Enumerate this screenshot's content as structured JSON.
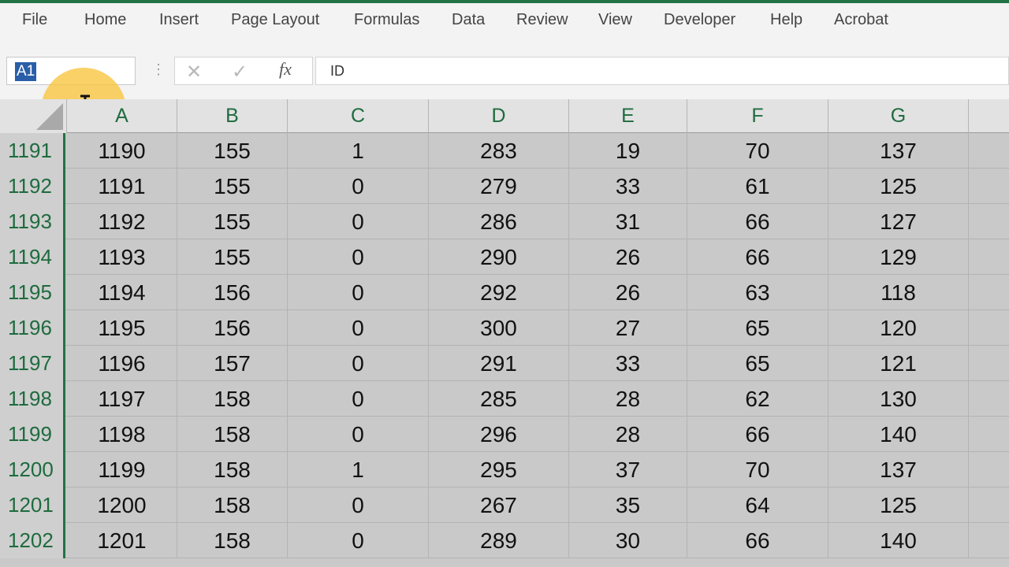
{
  "menu": [
    "File",
    "Home",
    "Insert",
    "Page Layout",
    "Formulas",
    "Data",
    "Review",
    "View",
    "Developer",
    "Help",
    "Acrobat"
  ],
  "name_box": {
    "value": "A1"
  },
  "formula_bar": {
    "cancel_glyph": "✕",
    "enter_glyph": "✓",
    "fx_label": "fx",
    "value": "ID"
  },
  "columns": [
    "A",
    "B",
    "C",
    "D",
    "E",
    "F",
    "G"
  ],
  "rows": [
    {
      "num": "1191",
      "cells": [
        "1190",
        "155",
        "1",
        "283",
        "19",
        "70",
        "137"
      ]
    },
    {
      "num": "1192",
      "cells": [
        "1191",
        "155",
        "0",
        "279",
        "33",
        "61",
        "125"
      ]
    },
    {
      "num": "1193",
      "cells": [
        "1192",
        "155",
        "0",
        "286",
        "31",
        "66",
        "127"
      ]
    },
    {
      "num": "1194",
      "cells": [
        "1193",
        "155",
        "0",
        "290",
        "26",
        "66",
        "129"
      ]
    },
    {
      "num": "1195",
      "cells": [
        "1194",
        "156",
        "0",
        "292",
        "26",
        "63",
        "118"
      ]
    },
    {
      "num": "1196",
      "cells": [
        "1195",
        "156",
        "0",
        "300",
        "27",
        "65",
        "120"
      ]
    },
    {
      "num": "1197",
      "cells": [
        "1196",
        "157",
        "0",
        "291",
        "33",
        "65",
        "121"
      ]
    },
    {
      "num": "1198",
      "cells": [
        "1197",
        "158",
        "0",
        "285",
        "28",
        "62",
        "130"
      ]
    },
    {
      "num": "1199",
      "cells": [
        "1198",
        "158",
        "0",
        "296",
        "28",
        "66",
        "140"
      ]
    },
    {
      "num": "1200",
      "cells": [
        "1199",
        "158",
        "1",
        "295",
        "37",
        "70",
        "137"
      ]
    },
    {
      "num": "1201",
      "cells": [
        "1200",
        "158",
        "0",
        "267",
        "35",
        "64",
        "125"
      ]
    },
    {
      "num": "1202",
      "cells": [
        "1201",
        "158",
        "0",
        "289",
        "30",
        "66",
        "140"
      ]
    }
  ],
  "colors": {
    "accent": "#217346",
    "header_text": "#1e6b3e",
    "selection": "#2a5ea8",
    "cursor_highlight": "#f7c43c"
  }
}
